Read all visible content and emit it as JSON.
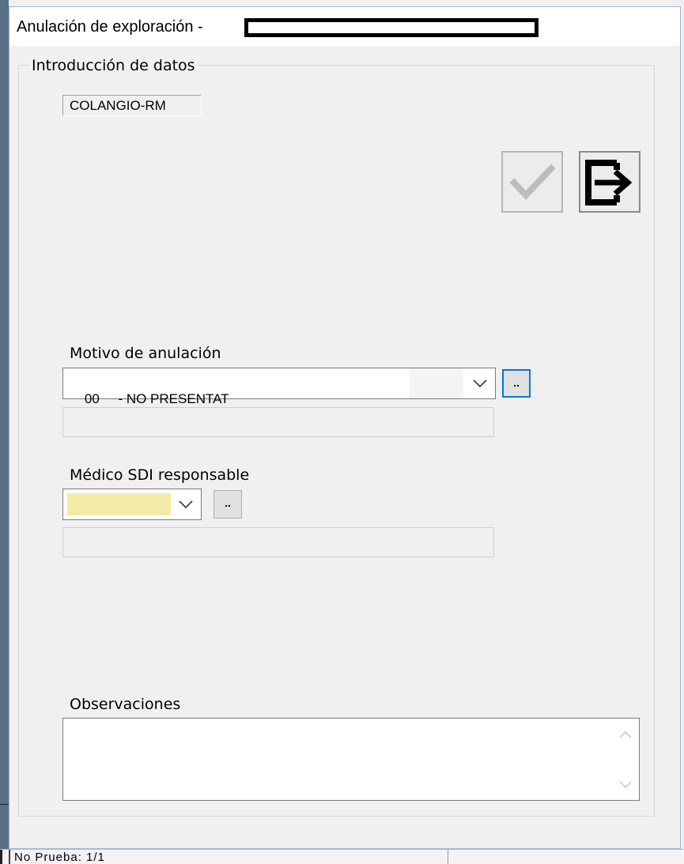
{
  "window": {
    "title": "Anulación de exploración -"
  },
  "group": {
    "legend": "Introducción de datos",
    "study_code": "COLANGIO-RM"
  },
  "toolbar": {
    "accept_icon": "check-icon",
    "exit_icon": "exit-arrow-icon"
  },
  "motivo": {
    "label": "Motivo de anulación",
    "code": "00",
    "text": "- NO PRESENTAT",
    "browse_label": ".."
  },
  "medico": {
    "label": "Médico SDI responsable",
    "browse_label": ".."
  },
  "observaciones": {
    "label": "Observaciones"
  },
  "background_status": {
    "text": "No Prueba: 1/1"
  },
  "colors": {
    "focus_blue": "#0078d7",
    "required_yellow": "#f2eba7"
  }
}
